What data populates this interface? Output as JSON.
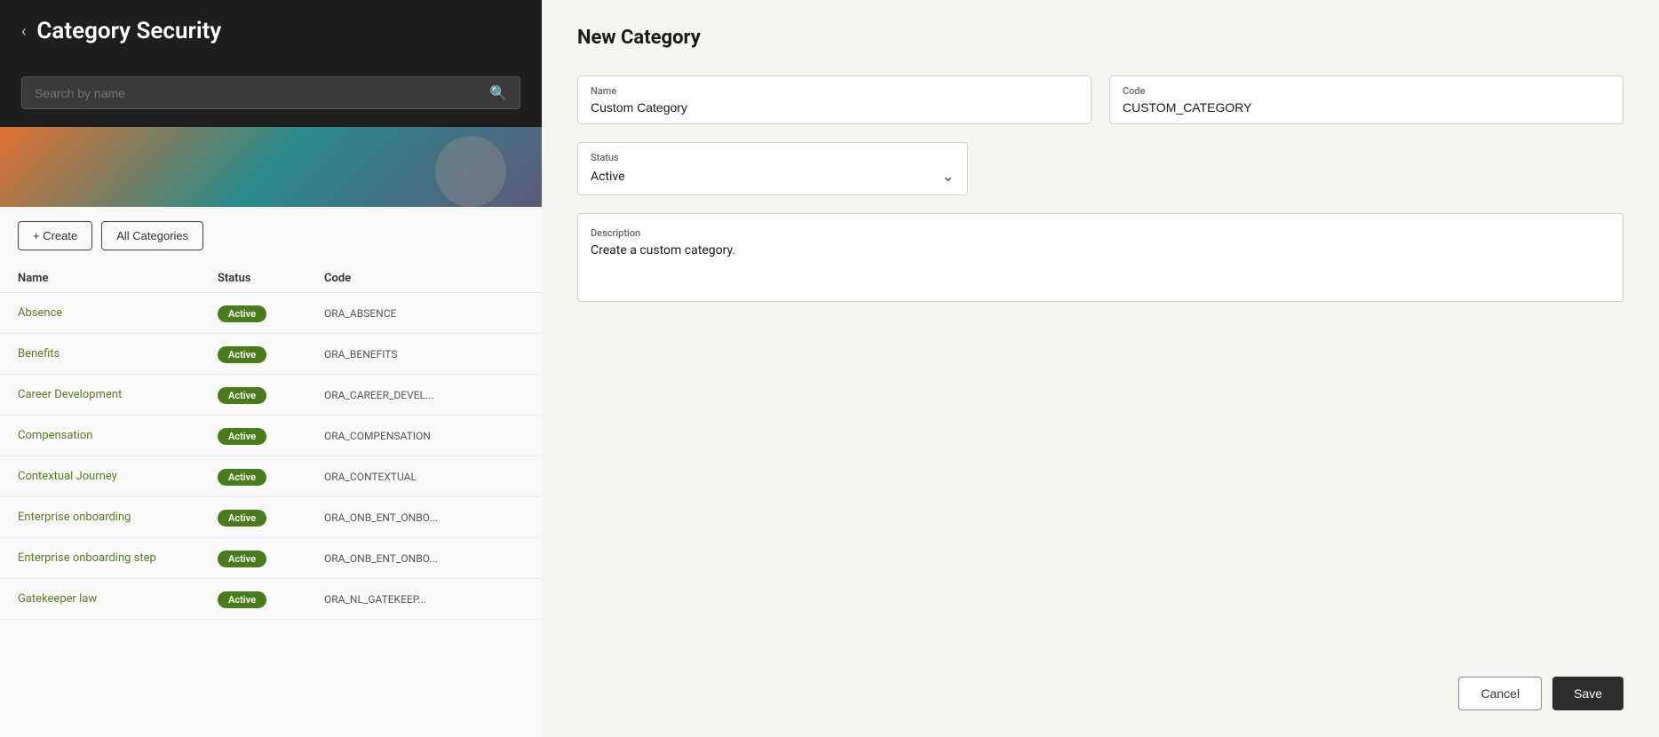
{
  "leftPanel": {
    "backArrow": "‹",
    "pageTitle": "Category Security",
    "searchPlaceholder": "Search by name",
    "createButtonLabel": "+ Create",
    "allCategoriesLabel": "All Categories",
    "tableHeaders": [
      "Name",
      "Status",
      "Code"
    ],
    "rows": [
      {
        "name": "Absence",
        "status": "Active",
        "code": "ORA_ABSENCE"
      },
      {
        "name": "Benefits",
        "status": "Active",
        "code": "ORA_BENEFITS"
      },
      {
        "name": "Career Development",
        "status": "Active",
        "code": "ORA_CAREER_DEVEL..."
      },
      {
        "name": "Compensation",
        "status": "Active",
        "code": "ORA_COMPENSATION"
      },
      {
        "name": "Contextual Journey",
        "status": "Active",
        "code": "ORA_CONTEXTUAL"
      },
      {
        "name": "Enterprise onboarding",
        "status": "Active",
        "code": "ORA_ONB_ENT_ONBO..."
      },
      {
        "name": "Enterprise onboarding step",
        "status": "Active",
        "code": "ORA_ONB_ENT_ONBO..."
      },
      {
        "name": "Gatekeeper law",
        "status": "Active",
        "code": "ORA_NL_GATEKEEP..."
      }
    ]
  },
  "rightPanel": {
    "formTitle": "New Category",
    "fields": {
      "nameLabel": "Name",
      "nameValue": "Custom Category",
      "codeLabel": "Code",
      "codeValue": "CUSTOM_CATEGORY",
      "statusLabel": "Status",
      "statusValue": "Active",
      "descriptionLabel": "Description",
      "descriptionValue": "Create a custom category."
    },
    "cancelLabel": "Cancel",
    "saveLabel": "Save"
  }
}
